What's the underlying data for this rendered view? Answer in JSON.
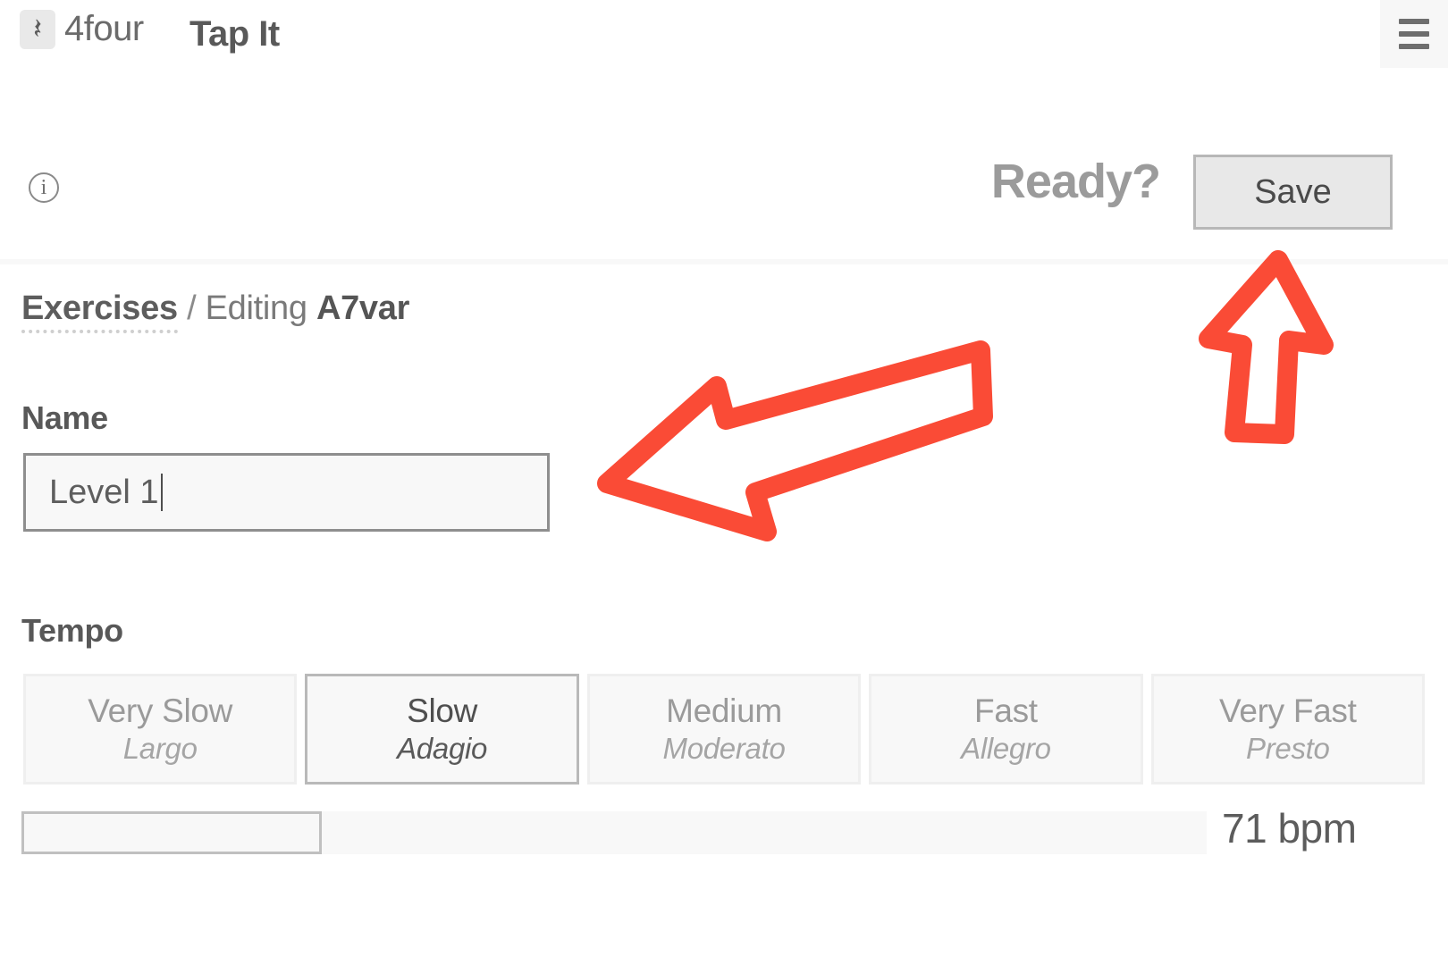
{
  "header": {
    "logo_icon": "quarter-rest-icon",
    "logo_glyph": "𝄽",
    "brand_name": "4four",
    "app_title": "Tap It",
    "menu_icon": "hamburger-menu-icon"
  },
  "actions": {
    "info_icon": "info-icon",
    "info_glyph": "i",
    "ready_label": "Ready?",
    "save_label": "Save"
  },
  "breadcrumb": {
    "root": "Exercises",
    "separator": "/",
    "action": "Editing",
    "current": "A7var"
  },
  "name_field": {
    "label": "Name",
    "value": "Level 1",
    "placeholder": "Name"
  },
  "tempo": {
    "label": "Tempo",
    "options": [
      {
        "main": "Very Slow",
        "sub": "Largo",
        "selected": false
      },
      {
        "main": "Slow",
        "sub": "Adagio",
        "selected": true
      },
      {
        "main": "Medium",
        "sub": "Moderato",
        "selected": false
      },
      {
        "main": "Fast",
        "sub": "Allegro",
        "selected": false
      },
      {
        "main": "Very Fast",
        "sub": "Presto",
        "selected": false
      }
    ],
    "bpm_value": "71 bpm",
    "bpm_number": 71,
    "slider_fill_percent": 25
  },
  "annotations": {
    "color": "#fa4b36",
    "left_arrow_name": "annotation-arrow-to-name-field",
    "up_arrow_name": "annotation-arrow-to-save-button"
  }
}
